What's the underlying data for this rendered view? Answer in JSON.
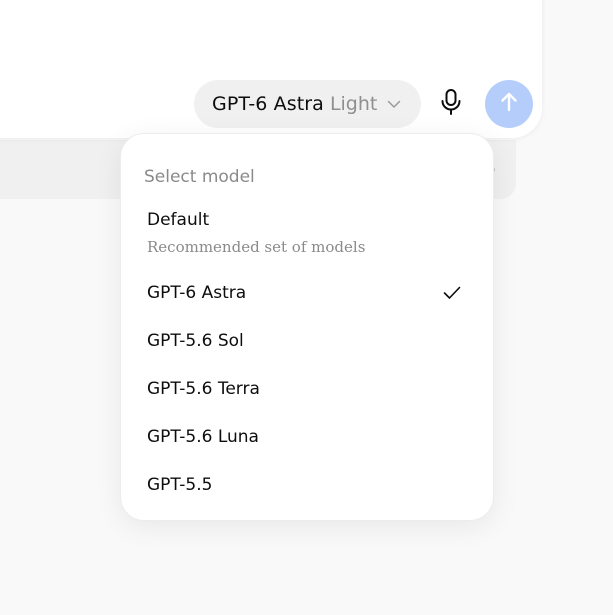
{
  "composer": {
    "model_pill": {
      "name": "GPT-6 Astra",
      "variant": "Light",
      "chevron_icon": "chevron-down-icon"
    },
    "mic_icon": "microphone-icon",
    "send_icon": "arrow-up-icon",
    "send_color": "#b4cdfb"
  },
  "background_strip": {
    "glyph": "o"
  },
  "model_menu": {
    "title": "Select model",
    "default": {
      "label": "Default",
      "description": "Recommended set of models"
    },
    "items": [
      {
        "label": "GPT-6 Astra",
        "selected": true
      },
      {
        "label": "GPT-5.6 Sol",
        "selected": false
      },
      {
        "label": "GPT-5.6 Terra",
        "selected": false
      },
      {
        "label": "GPT-5.6 Luna",
        "selected": false
      },
      {
        "label": "GPT-5.5",
        "selected": false
      }
    ],
    "check_icon": "check-icon"
  }
}
